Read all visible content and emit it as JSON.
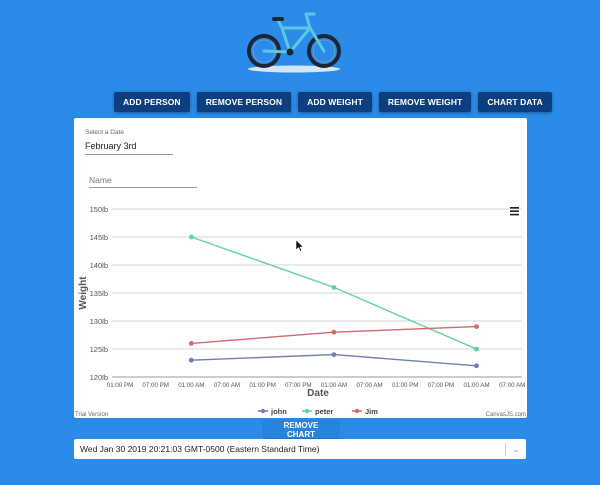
{
  "toolbar": {
    "add_person": "ADD PERSON",
    "remove_person": "REMOVE PERSON",
    "add_weight": "ADD WEIGHT",
    "remove_weight": "REMOVE WEIGHT",
    "chart_data": "CHART DATA"
  },
  "form": {
    "date_label": "Select a Date",
    "date_value": "February 3rd",
    "name_placeholder": "Name"
  },
  "chart_footer": {
    "trial": "Trial Version",
    "brand": "CanvasJS.com"
  },
  "remove_chart_label": "REMOVE CHART",
  "date_select": {
    "value": "Wed Jan 30 2019 20:21:03 GMT-0500 (Eastern Standard Time)"
  },
  "icons": {
    "menu": "hamburger-menu-icon",
    "chevron": "chevron-down-icon",
    "bike": "bicycle-icon",
    "cursor": "mouse-pointer-icon"
  },
  "colors": {
    "background": "#2b8be8",
    "button": "#0d3f80",
    "john": "#7080a8",
    "peter": "#5fd39a",
    "Jim": "#d26a6c"
  },
  "chart_data": {
    "type": "line",
    "ylabel": "Weight",
    "xlabel": "Date",
    "ylim": [
      120,
      150
    ],
    "y_ticks": [
      "120lb",
      "125lb",
      "130lb",
      "135lb",
      "140lb",
      "145lb",
      "150lb"
    ],
    "x_ticks": [
      "01:00 PM",
      "07:00 PM",
      "01:00 AM",
      "07:00 AM",
      "01:00 PM",
      "07:00 PM",
      "01:00 AM",
      "07:00 AM",
      "01:00 PM",
      "07:00 PM",
      "01:00 AM",
      "07:00 AM"
    ],
    "grid": true,
    "legend_position": "bottom",
    "series": [
      {
        "name": "john",
        "x_tick": [
          2,
          6,
          10
        ],
        "values": [
          123,
          124,
          122
        ]
      },
      {
        "name": "peter",
        "x_tick": [
          2,
          6,
          10
        ],
        "values": [
          145,
          136,
          125
        ]
      },
      {
        "name": "Jim",
        "x_tick": [
          2,
          6,
          10
        ],
        "values": [
          126,
          128,
          129
        ]
      }
    ]
  }
}
